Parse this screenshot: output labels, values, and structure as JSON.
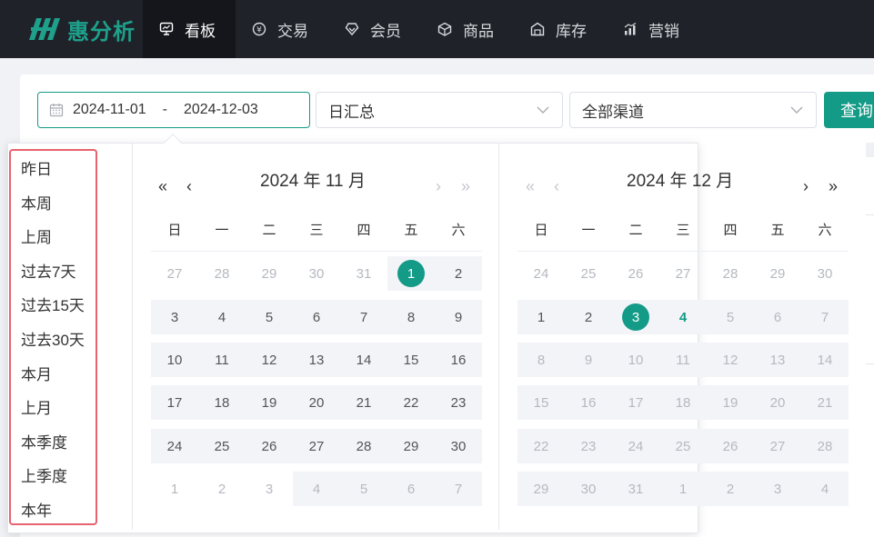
{
  "brand": {
    "name": "惠分析",
    "color": "#1ea08b"
  },
  "nav": [
    {
      "label": "看板",
      "icon": "dashboard-icon",
      "active": true
    },
    {
      "label": "交易",
      "icon": "money-icon",
      "active": false
    },
    {
      "label": "会员",
      "icon": "member-icon",
      "active": false
    },
    {
      "label": "商品",
      "icon": "box-icon",
      "active": false
    },
    {
      "label": "库存",
      "icon": "warehouse-icon",
      "active": false
    },
    {
      "label": "营销",
      "icon": "chart-icon",
      "active": false
    }
  ],
  "filters": {
    "start_date": "2024-11-01",
    "range_separator": "-",
    "end_date": "2024-12-03",
    "summary_select": "日汇总",
    "channel_select": "全部渠道",
    "query_label": "查询"
  },
  "shortcuts": [
    "昨日",
    "本周",
    "上周",
    "过去7天",
    "过去15天",
    "过去30天",
    "本月",
    "上月",
    "本季度",
    "上季度",
    "本年"
  ],
  "weekdays": [
    "日",
    "一",
    "二",
    "三",
    "四",
    "五",
    "六"
  ],
  "nav_glyphs": {
    "prev_year": "«",
    "prev_month": "‹",
    "next_month": "›",
    "next_year": "»"
  },
  "calendar_left": {
    "title": "2024 年 11 月",
    "weeks": [
      [
        "27",
        "28",
        "29",
        "30",
        "31",
        "1",
        "2"
      ],
      [
        "3",
        "4",
        "5",
        "6",
        "7",
        "8",
        "9"
      ],
      [
        "10",
        "11",
        "12",
        "13",
        "14",
        "15",
        "16"
      ],
      [
        "17",
        "18",
        "19",
        "20",
        "21",
        "22",
        "23"
      ],
      [
        "24",
        "25",
        "26",
        "27",
        "28",
        "29",
        "30"
      ],
      [
        "1",
        "2",
        "3",
        "4",
        "5",
        "6",
        "7"
      ]
    ]
  },
  "calendar_right": {
    "title": "2024 年 12 月",
    "weeks": [
      [
        "24",
        "25",
        "26",
        "27",
        "28",
        "29",
        "30"
      ],
      [
        "1",
        "2",
        "3",
        "4",
        "5",
        "6",
        "7"
      ],
      [
        "8",
        "9",
        "10",
        "11",
        "12",
        "13",
        "14"
      ],
      [
        "15",
        "16",
        "17",
        "18",
        "19",
        "20",
        "21"
      ],
      [
        "22",
        "23",
        "24",
        "25",
        "26",
        "27",
        "28"
      ],
      [
        "29",
        "30",
        "31",
        "1",
        "2",
        "3",
        "4"
      ]
    ]
  },
  "colors": {
    "accent": "#139b87",
    "highlight": "#e8626f",
    "topbar": "#1f2229"
  }
}
